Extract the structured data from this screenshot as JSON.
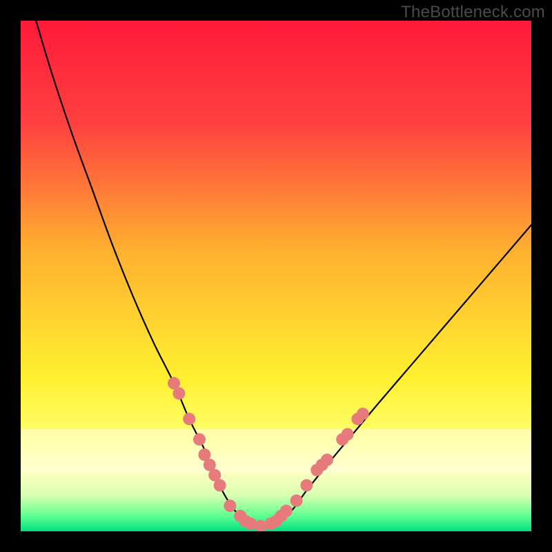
{
  "watermark": "TheBottleneck.com",
  "chart_data": {
    "type": "line",
    "title": "",
    "xlabel": "",
    "ylabel": "",
    "xlim": [
      0,
      100
    ],
    "ylim": [
      0,
      100
    ],
    "grid": false,
    "background": {
      "type": "vertical-gradient",
      "stops": [
        {
          "pos": 0.0,
          "color": "#ff1a3a"
        },
        {
          "pos": 0.2,
          "color": "#ff4040"
        },
        {
          "pos": 0.45,
          "color": "#ffb030"
        },
        {
          "pos": 0.7,
          "color": "#fff030"
        },
        {
          "pos": 0.82,
          "color": "#ffff70"
        },
        {
          "pos": 0.88,
          "color": "#ffffc0"
        },
        {
          "pos": 0.93,
          "color": "#d8ffb0"
        },
        {
          "pos": 0.97,
          "color": "#60ff90"
        },
        {
          "pos": 1.0,
          "color": "#00e080"
        }
      ]
    },
    "series": [
      {
        "name": "bottleneck-curve",
        "color": "#000000",
        "width": 2.2,
        "x": [
          3,
          6,
          10,
          14,
          18,
          22,
          26,
          30,
          33,
          36,
          38,
          40,
          42,
          44,
          46,
          48,
          50,
          53,
          56,
          60,
          65,
          70,
          76,
          82,
          88,
          94,
          100
        ],
        "y": [
          100,
          90,
          78,
          67,
          56,
          46,
          37,
          29,
          22,
          16,
          11,
          7,
          4,
          2,
          1,
          1,
          2,
          4,
          8,
          13,
          19,
          25,
          32,
          39,
          46,
          53,
          60
        ]
      }
    ],
    "markers": {
      "name": "highlighted-points",
      "color": "#e77a7a",
      "radius": 9,
      "points": [
        {
          "x": 30,
          "y": 29
        },
        {
          "x": 31,
          "y": 27
        },
        {
          "x": 33,
          "y": 22
        },
        {
          "x": 35,
          "y": 18
        },
        {
          "x": 36,
          "y": 15
        },
        {
          "x": 37,
          "y": 13
        },
        {
          "x": 38,
          "y": 11
        },
        {
          "x": 39,
          "y": 9
        },
        {
          "x": 41,
          "y": 5
        },
        {
          "x": 43,
          "y": 3
        },
        {
          "x": 44,
          "y": 2
        },
        {
          "x": 45,
          "y": 1.5
        },
        {
          "x": 47,
          "y": 1
        },
        {
          "x": 49,
          "y": 1.5
        },
        {
          "x": 50,
          "y": 2
        },
        {
          "x": 51,
          "y": 3
        },
        {
          "x": 52,
          "y": 4
        },
        {
          "x": 54,
          "y": 6
        },
        {
          "x": 56,
          "y": 9
        },
        {
          "x": 58,
          "y": 12
        },
        {
          "x": 59,
          "y": 13
        },
        {
          "x": 60,
          "y": 14
        },
        {
          "x": 63,
          "y": 18
        },
        {
          "x": 64,
          "y": 19
        },
        {
          "x": 66,
          "y": 22
        },
        {
          "x": 67,
          "y": 23
        }
      ]
    }
  }
}
